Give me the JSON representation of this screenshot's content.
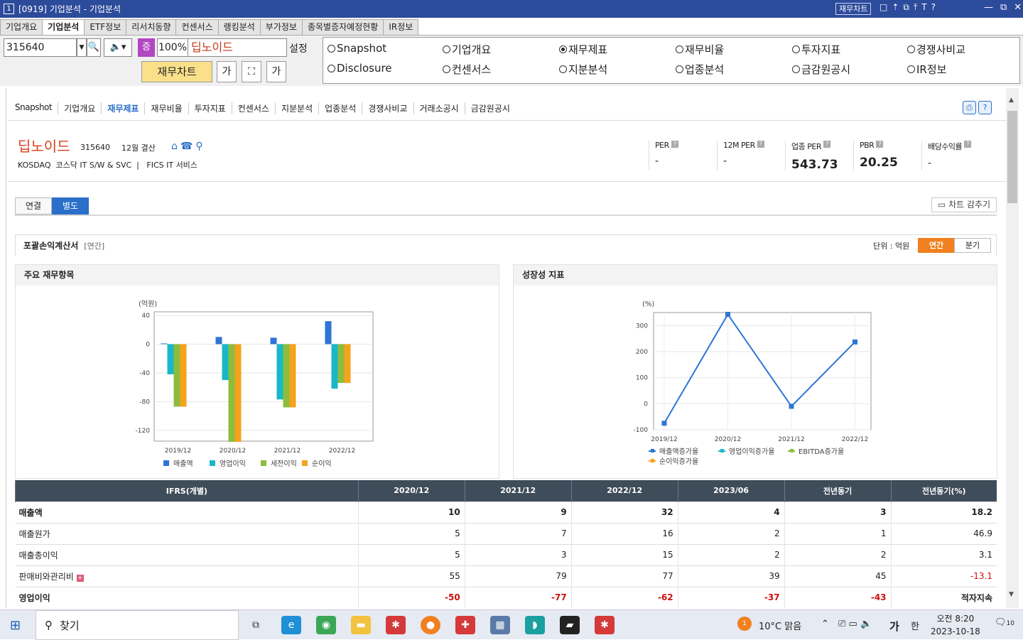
{
  "window": {
    "num": "1",
    "title": "[0919] 기업분석 - 기업분석",
    "badge": "재무차트",
    "tools": [
      "□",
      "⇡",
      "⧉",
      "⤒",
      "T",
      "?"
    ],
    "win_ctrls": [
      "—",
      "⧉",
      "✕"
    ]
  },
  "tabs": [
    "기업개요",
    "기업분석",
    "ETF정보",
    "리서치동향",
    "컨센서스",
    "랭킹분석",
    "부가정보",
    "종목별증자예정현황",
    "IR정보"
  ],
  "toolbar": {
    "code": "315640",
    "zoom_label": "증",
    "zoom": "100%",
    "stock_name": "딥노이드",
    "setting": "설정",
    "chart_btn": "재무차트",
    "font_btn": "가",
    "fit_btn": "⛶",
    "font2_btn": "가"
  },
  "radios": [
    {
      "label": "Snapshot",
      "selected": false
    },
    {
      "label": "기업개요",
      "selected": false
    },
    {
      "label": "재무제표",
      "selected": true
    },
    {
      "label": "재무비율",
      "selected": false
    },
    {
      "label": "투자지표",
      "selected": false
    },
    {
      "label": "경쟁사비교",
      "selected": false
    },
    {
      "label": "Disclosure",
      "selected": false
    },
    {
      "label": "컨센서스",
      "selected": false
    },
    {
      "label": "지분분석",
      "selected": false
    },
    {
      "label": "업종분석",
      "selected": false
    },
    {
      "label": "금감원공시",
      "selected": false
    },
    {
      "label": "IR정보",
      "selected": false
    }
  ],
  "subnav": [
    "Snapshot",
    "기업개요",
    "재무제표",
    "재무비율",
    "투자지표",
    "컨센서스",
    "지분분석",
    "업종분석",
    "경쟁사비교",
    "거래소공시",
    "금감원공시"
  ],
  "subnav_active": "재무제표",
  "company": {
    "name": "딥노이드",
    "code": "315640",
    "fiscal": "12월 결산",
    "market": "KOSDAQ",
    "sector": "코스닥 IT S/W & SVC",
    "fics": "FICS IT 서비스"
  },
  "metrics": [
    {
      "label": "PER",
      "value": "-"
    },
    {
      "label": "12M PER",
      "value": "-"
    },
    {
      "label": "업종 PER",
      "value": "543.73"
    },
    {
      "label": "PBR",
      "value": "20.25"
    },
    {
      "label": "배당수익률",
      "value": "-"
    }
  ],
  "view_tabs": [
    "연결",
    "별도"
  ],
  "hide_chart": "차트 감추기",
  "section": {
    "title": "포괄손익계산서",
    "sub": "[연간]",
    "unit": "단위 : 억원",
    "periods": [
      "연간",
      "분기"
    ]
  },
  "panels": {
    "left": "주요 재무항목",
    "right": "성장성 지표"
  },
  "chart_data": [
    {
      "type": "bar",
      "ylabel": "(억원)",
      "categories": [
        "2019/12",
        "2020/12",
        "2021/12",
        "2022/12"
      ],
      "ylim": [
        -135,
        45
      ],
      "yticks": [
        40,
        0,
        -40,
        -80,
        -120
      ],
      "series": [
        {
          "name": "매출액",
          "color": "#2e75d6",
          "values": [
            1,
            10,
            9,
            32
          ]
        },
        {
          "name": "영업이익",
          "color": "#18b8c8",
          "values": [
            -42,
            -50,
            -77,
            -62
          ]
        },
        {
          "name": "세전이익",
          "color": "#8cbd3c",
          "values": [
            -87,
            -136,
            -88,
            -54
          ]
        },
        {
          "name": "순이익",
          "color": "#f5a21c",
          "values": [
            -87,
            -136,
            -88,
            -54
          ]
        }
      ]
    },
    {
      "type": "line",
      "ylabel": "(%)",
      "categories": [
        "2019/12",
        "2020/12",
        "2021/12",
        "2022/12"
      ],
      "ylim": [
        -100,
        350
      ],
      "yticks": [
        300,
        200,
        100,
        0,
        -100
      ],
      "series": [
        {
          "name": "매출액증가율",
          "color": "#2e75d6",
          "values": [
            -75,
            343,
            -10,
            237
          ]
        },
        {
          "name": "영업이익증가율",
          "color": "#18b8c8",
          "values": []
        },
        {
          "name": "EBITDA증가율",
          "color": "#8cbd3c",
          "values": []
        },
        {
          "name": "순이익증가율",
          "color": "#f5a21c",
          "values": []
        }
      ]
    }
  ],
  "table": {
    "headers": [
      "IFRS(개별)",
      "2020/12",
      "2021/12",
      "2022/12",
      "2023/06",
      "전년동기",
      "전년동기(%)"
    ],
    "rows": [
      {
        "label": "매출액",
        "bold": true,
        "vals": [
          "10",
          "9",
          "32",
          "4",
          "3",
          "18.2"
        ]
      },
      {
        "label": "매출원가",
        "bold": false,
        "vals": [
          "5",
          "7",
          "16",
          "2",
          "1",
          "46.9"
        ]
      },
      {
        "label": "매출총이익",
        "bold": false,
        "vals": [
          "5",
          "3",
          "15",
          "2",
          "2",
          "3.1"
        ]
      },
      {
        "label": "판매비와관리비",
        "bold": false,
        "plus": true,
        "vals": [
          "55",
          "79",
          "77",
          "39",
          "45",
          "-13.1"
        ]
      },
      {
        "label": "영업이익",
        "bold": true,
        "vals": [
          "-50",
          "-77",
          "-62",
          "-37",
          "-43",
          "적자지속"
        ]
      }
    ]
  },
  "taskbar": {
    "search": "찾기",
    "weather": "10°C 맑음",
    "weather_badge": "1",
    "ime": "가",
    "lang": "한",
    "time": "오전 8:20",
    "date": "2023-10-18",
    "notif": "10"
  }
}
